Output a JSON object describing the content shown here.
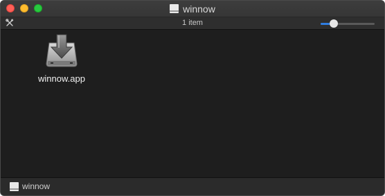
{
  "window": {
    "title": "winnow",
    "title_icon": "drive-icon"
  },
  "traffic_lights": {
    "close_color": "#ff5f57",
    "minimize_color": "#febc2e",
    "zoom_color": "#28c840"
  },
  "toolbar": {
    "tools_icon": "tools-icon",
    "item_count": "1 item",
    "icon_size_slider": {
      "level": 0.2,
      "accent": "#2f7de1"
    }
  },
  "files": [
    {
      "name": "winnow.app",
      "icon": "installer-drive-icon"
    }
  ],
  "pathbar": {
    "label": "winnow",
    "icon": "drive-icon"
  }
}
